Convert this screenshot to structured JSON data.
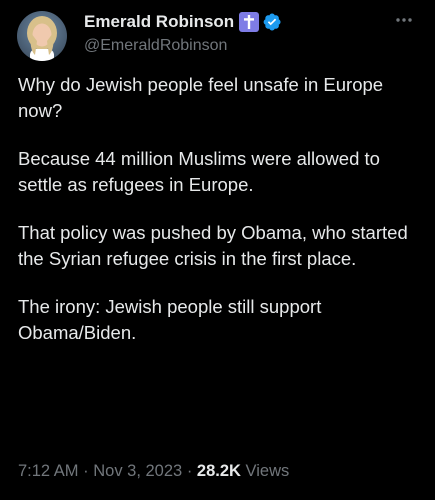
{
  "author": {
    "display_name": "Emerald Robinson",
    "handle": "@EmeraldRobinson",
    "avatar": "avatar-photo",
    "badges": [
      "cross-icon",
      "verified-badge-icon"
    ]
  },
  "post": {
    "paragraphs": [
      "Why do Jewish people feel unsafe in Europe now?",
      "Because 44 million Muslims were allowed to settle as refugees in Europe.",
      "That policy was pushed by Obama, who started the Syrian refugee crisis in the first place.",
      "The irony: Jewish people still support Obama/Biden."
    ]
  },
  "meta": {
    "time": "7:12 AM",
    "separator": "·",
    "date": "Nov 3, 2023",
    "views_count": "28.2K",
    "views_label": "Views"
  },
  "icons": {
    "more": "more-horizontal-icon"
  },
  "colors": {
    "background": "#000000",
    "text_primary": "#e7e9ea",
    "text_secondary": "#71767b",
    "verified_blue": "#1d9bf0",
    "cross_badge": "#7e7ce6"
  }
}
